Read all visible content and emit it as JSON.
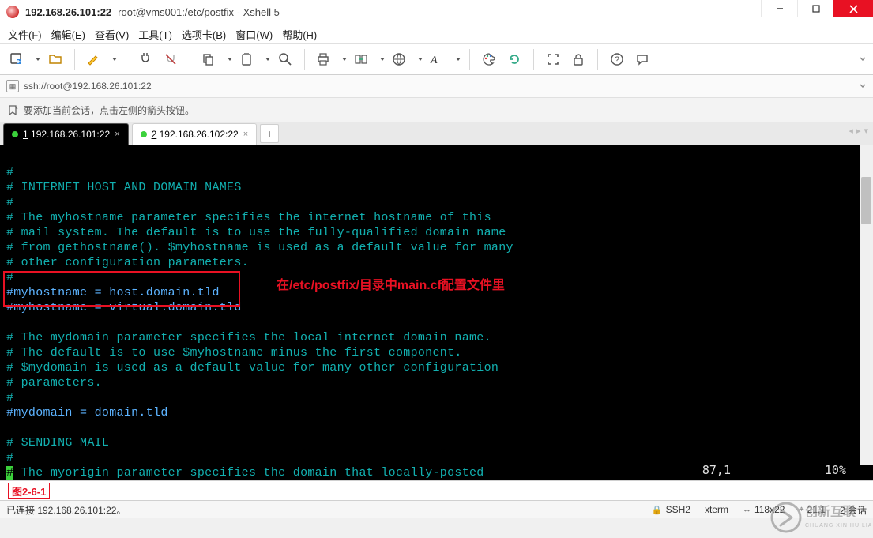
{
  "titlebar": {
    "main": "192.168.26.101:22",
    "sub": "root@vms001:/etc/postfix - Xshell 5"
  },
  "menu": {
    "file": "文件(F)",
    "edit": "编辑(E)",
    "view": "查看(V)",
    "tools": "工具(T)",
    "tabs": "选项卡(B)",
    "window": "窗口(W)",
    "help": "帮助(H)"
  },
  "addressbar": {
    "url": "ssh://root@192.168.26.101:22"
  },
  "hint": {
    "text": "要添加当前会话，点击左侧的箭头按钮。"
  },
  "tabs": {
    "t1_prefix": "1",
    "t1_label": " 192.168.26.101:22",
    "t2_prefix": "2",
    "t2_label": " 192.168.26.102:22"
  },
  "terminal": {
    "lines": [
      "#",
      "# INTERNET HOST AND DOMAIN NAMES",
      "#",
      "# The myhostname parameter specifies the internet hostname of this",
      "# mail system. The default is to use the fully-qualified domain name",
      "# from gethostname(). $myhostname is used as a default value for many",
      "# other configuration parameters.",
      "#",
      "#myhostname = host.domain.tld",
      "#myhostname = virtual.domain.tld",
      "",
      "# The mydomain parameter specifies the local internet domain name.",
      "# The default is to use $myhostname minus the first component.",
      "# $mydomain is used as a default value for many other configuration",
      "# parameters.",
      "#",
      "#mydomain = domain.tld",
      "",
      "# SENDING MAIL",
      "#"
    ],
    "cursor_line_prefix": "#",
    "cursor_line_rest": " The myorigin parameter specifies the domain that locally-posted",
    "position": "87,1",
    "percent": "10%"
  },
  "annotation": "在/etc/postfix/目录中main.cf配置文件里",
  "figcaption": "图2-6-1",
  "status": {
    "left": "已连接 192.168.26.101:22。",
    "ssh": "SSH2",
    "term": "xterm",
    "size": "118x22",
    "cursor": "21,1",
    "sessions": "2 会话"
  },
  "watermark": {
    "title": "创新互联",
    "sub": "CHUANG XIN HU LIAN"
  }
}
